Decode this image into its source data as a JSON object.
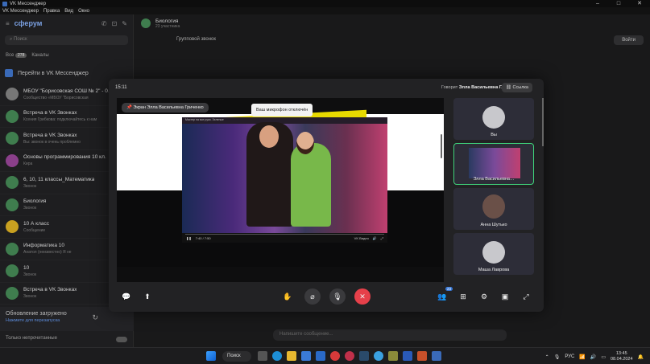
{
  "window": {
    "title": "VK Мессенджер"
  },
  "menu": [
    "VK Мессенджер",
    "Правка",
    "Вид",
    "Окно"
  ],
  "sidebar": {
    "brand": "сферум",
    "search_placeholder": "Поиск",
    "tabs": [
      {
        "label": "Все",
        "badge": "278"
      },
      {
        "label": "Каналы"
      }
    ],
    "vk_link": "Перейти в VK Мессенджер",
    "chats": [
      {
        "name": "МБОУ \"Борисовская СОШ № 2\" - 0…",
        "preview": "Сообщество «МБОУ \"Борисовская",
        "color": "#777777"
      },
      {
        "name": "Встреча в VK Звонках",
        "preview": "Ксения Грибкова: подключайтесь к нам",
        "color": "#3f7d4e"
      },
      {
        "name": "Встреча в VK Звонках",
        "preview": "Вы: звонок в очень проблемно",
        "color": "#3f7d4e"
      },
      {
        "name": "Основы программирования 10 кл.",
        "preview": "Кира",
        "color": "#8a3f8a"
      },
      {
        "name": "6, 10, 11 классы_Математика",
        "preview": "Звонок",
        "color": "#3f7d4e"
      },
      {
        "name": "Биология",
        "preview": "Звонок",
        "color": "#3f7d4e"
      },
      {
        "name": "10 А класс",
        "preview": "Сообщение",
        "color": "#c8a020"
      },
      {
        "name": "Информатика 10",
        "preview": "Анатол (неизвестно) Я не",
        "color": "#3f7d4e"
      },
      {
        "name": "10",
        "preview": "Звонок",
        "color": "#3f7d4e"
      },
      {
        "name": "Встреча в VK Звонках",
        "preview": "Звонок",
        "color": "#3f7d4e"
      }
    ],
    "update_title": "Обновление загружено",
    "update_sub": "Нажмите для перезапуска",
    "toggle_label": "Только непрочитанные"
  },
  "chat": {
    "title": "Биология",
    "subtitle": "23 участника",
    "call_label": "Групповой звонок",
    "join_label": "Войти",
    "input_placeholder": "Напишите сообщение..."
  },
  "call": {
    "time": "15:11",
    "speaking_prefix": "Говорит",
    "speaking_name": "Элла Васильевна Г.",
    "link_label": "Ссылка",
    "screen_label": "Экран Элла Васильевна Гриченко",
    "mic_notice": "Ваш микрофон отключён",
    "video_title": "Мастер на все руки. Зеленые",
    "video_time": "7:40 / 7:50",
    "video_brand": "VK Видео",
    "participants": [
      {
        "name": "Вы",
        "kind": "avatar"
      },
      {
        "name": "Элла Васильевна…",
        "kind": "screen",
        "active": true
      },
      {
        "name": "Анна Шутько",
        "kind": "photo"
      },
      {
        "name": "Маша Лаврова",
        "kind": "avatar"
      }
    ],
    "toolbar": [
      {
        "icon": "chat-icon",
        "symbol": "💬"
      },
      {
        "icon": "screen-share-icon",
        "symbol": "⬆"
      },
      {
        "icon": "raise-hand-icon",
        "symbol": "✋"
      },
      {
        "icon": "camera-off-icon",
        "symbol": "⌀"
      },
      {
        "icon": "mic-off-icon",
        "symbol": "🎙"
      },
      {
        "icon": "end-call-icon",
        "symbol": "✕"
      },
      {
        "icon": "participants-icon",
        "symbol": "👥",
        "badge": "23"
      },
      {
        "icon": "grid-icon",
        "symbol": "⊞"
      },
      {
        "icon": "settings-icon",
        "symbol": "⚙"
      },
      {
        "icon": "pip-icon",
        "symbol": "▣"
      },
      {
        "icon": "fullscreen-icon",
        "symbol": "⤢"
      }
    ]
  },
  "taskbar": {
    "search": "Поиск",
    "lang": "РУС",
    "time": "13:45",
    "date": "08.04.2024"
  }
}
